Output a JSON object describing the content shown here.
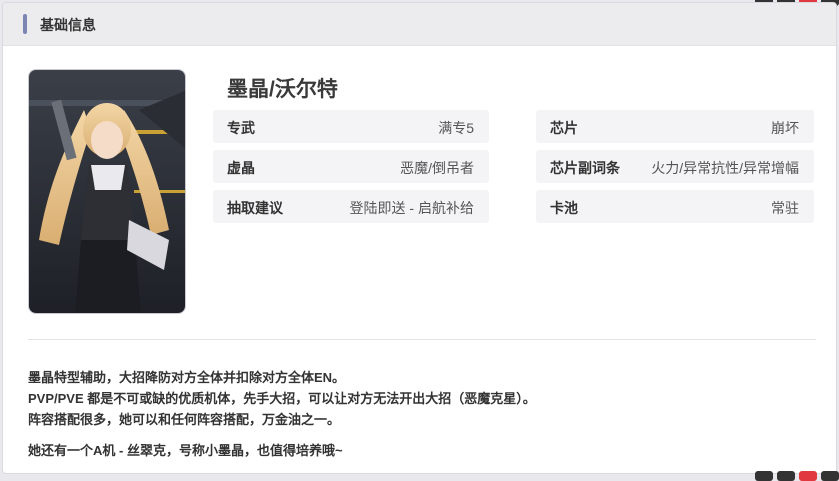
{
  "header": {
    "title": "基础信息"
  },
  "character": {
    "name": "墨晶/沃尔特"
  },
  "info_left": [
    {
      "key": "专武",
      "value": "满专5"
    },
    {
      "key": "虚晶",
      "value": "恶魔/倒吊者"
    },
    {
      "key": "抽取建议",
      "value": "登陆即送 - 启航补给"
    }
  ],
  "info_right": [
    {
      "key": "芯片",
      "value": "崩坏"
    },
    {
      "key": "芯片副词条",
      "value": "火力/异常抗性/异常增幅"
    },
    {
      "key": "卡池",
      "value": "常驻"
    }
  ],
  "description": {
    "lines": [
      "墨晶特型辅助，大招降防对方全体并扣除对方全体EN。",
      "PVP/PVE 都是不可或缺的优质机体，先手大招，可以让对方无法开出大招（恶魔克星）。",
      "阵容搭配很多，她可以和任何阵容搭配，万金油之一。"
    ],
    "extra": "她还有一个A机 - 丝翠克，号称小墨晶，也值得培养哦~"
  },
  "colors": {
    "accent_bar": "#7d86b3",
    "icon_red": "#e0383e",
    "icon_dark": "#333333"
  }
}
